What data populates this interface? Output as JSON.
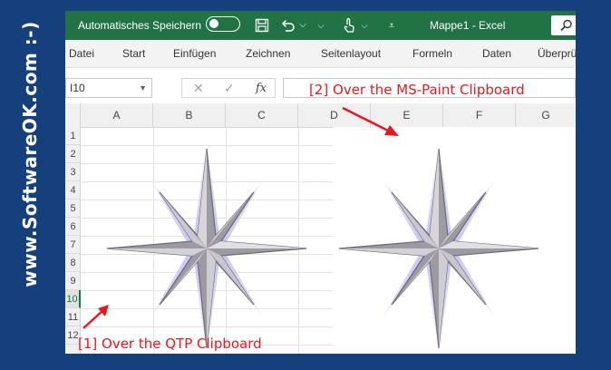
{
  "watermark": {
    "text": "www.SoftwareOK.com :-)"
  },
  "titlebar": {
    "autosave_label": "Automatisches Speichern",
    "document_title": "Mappe1  -  Excel",
    "icons": [
      "save-icon",
      "undo-icon",
      "touch-mode-icon",
      "customize-icon",
      "search-icon"
    ]
  },
  "ribbon": {
    "tabs": [
      "Datei",
      "Start",
      "Einfügen",
      "Zeichnen",
      "Seitenlayout",
      "Formeln",
      "Daten",
      "Überprü"
    ]
  },
  "formula_bar": {
    "name_box": "I10",
    "cancel_glyph": "✕",
    "enter_glyph": "✓",
    "fx_label": "fx",
    "formula_value": ""
  },
  "sheet": {
    "columns": [
      "A",
      "B",
      "C",
      "D",
      "E",
      "F",
      "G"
    ],
    "rows": [
      "1",
      "2",
      "3",
      "4",
      "5",
      "6",
      "7",
      "8",
      "9",
      "10",
      "11",
      "12"
    ],
    "active_row": "10"
  },
  "annotations": {
    "first": "[1] Over the QTP Clipboard",
    "second": "[2] Over the MS-Paint Clipboard"
  },
  "colors": {
    "title_bar": "#217346",
    "annotation": "#e8161e",
    "watermark_bg": "#15407c"
  }
}
